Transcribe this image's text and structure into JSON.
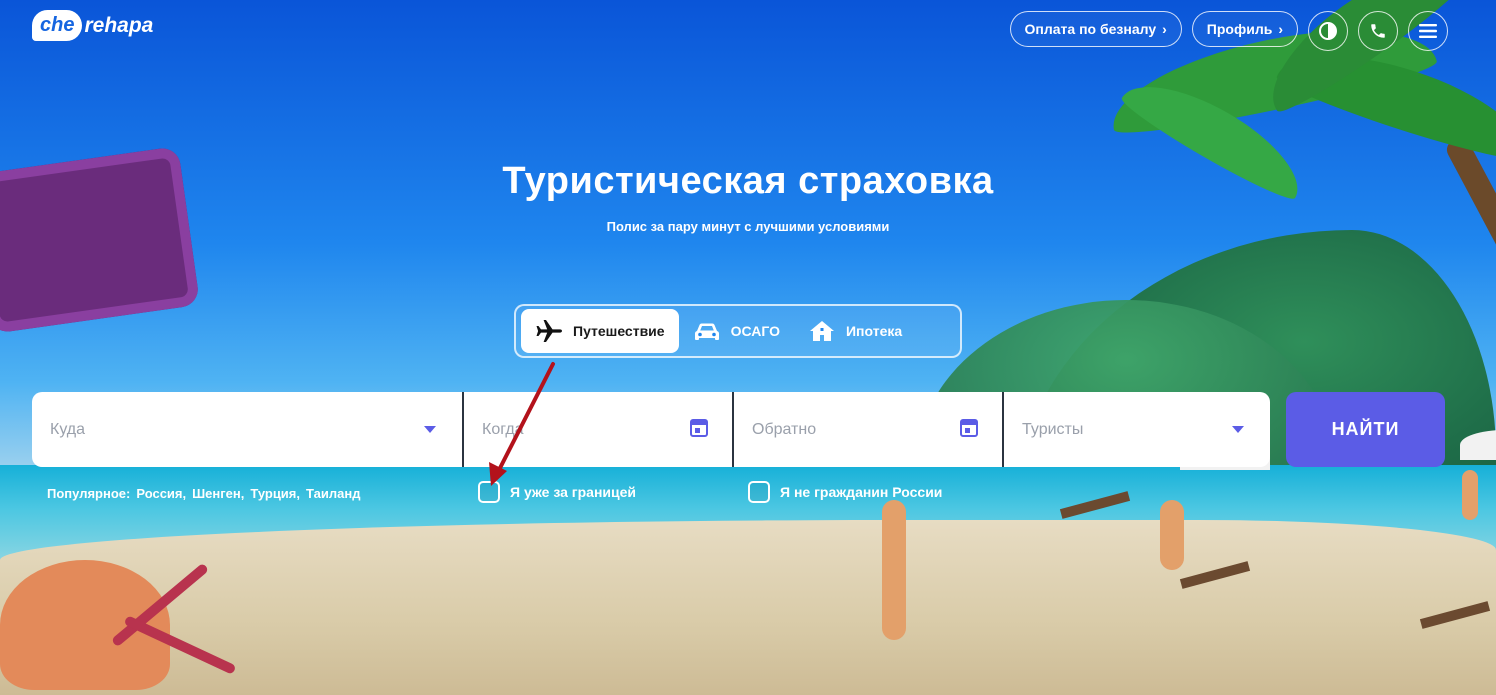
{
  "header": {
    "logo_bubble": "che",
    "logo_text": "rehapa",
    "nav": {
      "cashless_label": "Оплата по безналу",
      "profile_label": "Профиль"
    }
  },
  "hero": {
    "title": "Туристическая страховка",
    "subtitle": "Полис за пару минут с лучшими условиями"
  },
  "tabs": [
    {
      "label": "Путешествие",
      "icon": "airplane-icon",
      "active": true
    },
    {
      "label": "ОСАГО",
      "icon": "car-icon",
      "active": false
    },
    {
      "label": "Ипотека",
      "icon": "house-icon",
      "active": false
    }
  ],
  "search": {
    "where_placeholder": "Куда",
    "when_placeholder": "Когда",
    "back_placeholder": "Обратно",
    "tourists_placeholder": "Туристы",
    "find_label": "НАЙТИ"
  },
  "popular": {
    "label": "Популярное:",
    "items": [
      "Россия,",
      "Шенген,",
      "Турция,",
      "Таиланд"
    ]
  },
  "checkboxes": {
    "abroad_label": "Я уже за границей",
    "non_citizen_label": "Я не гражданин России"
  },
  "colors": {
    "accent": "#5b5ce6",
    "annotation_arrow": "#b3121b"
  }
}
